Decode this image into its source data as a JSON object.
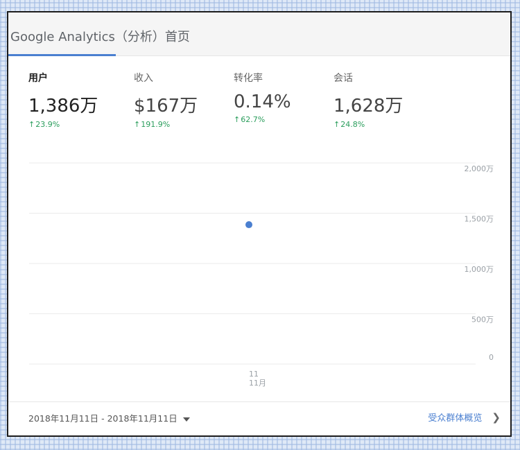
{
  "header": {
    "title": "Google Analytics（分析）首页"
  },
  "metrics": [
    {
      "label": "用户",
      "value": "1,386万",
      "delta": "23.9%",
      "active": true
    },
    {
      "label": "收入",
      "value": "$167万",
      "delta": "191.9%",
      "active": false
    },
    {
      "label": "转化率",
      "value": "0.14%",
      "delta": "62.7%",
      "active": false
    },
    {
      "label": "会话",
      "value": "1,628万",
      "delta": "24.8%",
      "active": false
    }
  ],
  "chart_data": {
    "type": "scatter",
    "title": "",
    "xlabel": "",
    "ylabel": "",
    "ylim": [
      0,
      20000000
    ],
    "ytick_labels": [
      "2,000万",
      "1,500万",
      "1,000万",
      "500万",
      "0"
    ],
    "ytick_values": [
      20000000,
      15000000,
      10000000,
      5000000,
      0
    ],
    "x_tick_labels": [
      [
        "11",
        "11月"
      ]
    ],
    "series": [
      {
        "x": [
          "2018-11-11"
        ],
        "values": [
          13860000
        ]
      }
    ],
    "grid": true,
    "point_color": "#4a7fd0",
    "y_axis_side": "right"
  },
  "footer": {
    "date_range": "2018年11月11日 - 2018年11月11日",
    "link_label": "受众群体概览"
  },
  "colors": {
    "accent": "#4a7fd0",
    "positive": "#2a9d5c"
  }
}
